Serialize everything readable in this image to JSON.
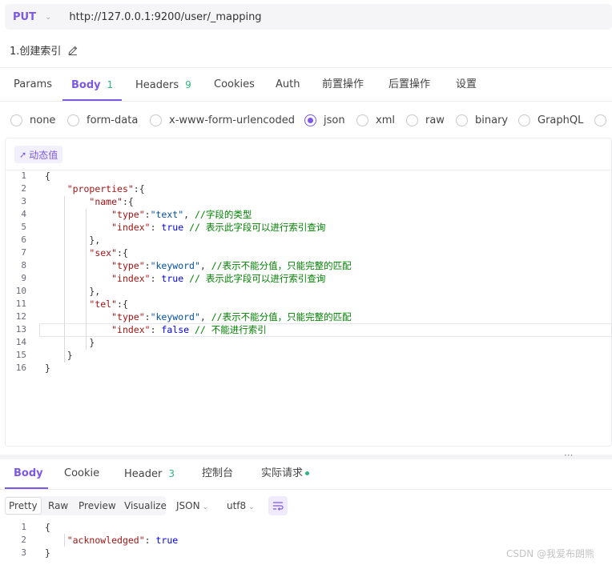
{
  "request": {
    "method": "PUT",
    "url": "http://127.0.0.1:9200/user/_mapping",
    "name": "1.创建索引"
  },
  "tabs": [
    {
      "label": "Params",
      "count": ""
    },
    {
      "label": "Body",
      "count": "1"
    },
    {
      "label": "Headers",
      "count": "9"
    },
    {
      "label": "Cookies",
      "count": ""
    },
    {
      "label": "Auth",
      "count": ""
    },
    {
      "label": "前置操作",
      "count": ""
    },
    {
      "label": "后置操作",
      "count": ""
    },
    {
      "label": "设置",
      "count": ""
    }
  ],
  "active_tab": "Body",
  "body_types": [
    "none",
    "form-data",
    "x-www-form-urlencoded",
    "json",
    "xml",
    "raw",
    "binary",
    "GraphQL"
  ],
  "selected_body_type": "json",
  "dynamic_value_label": "动态值",
  "code_lines": [
    {
      "n": "1",
      "text": "{"
    },
    {
      "n": "2",
      "text": "    \"properties\":{"
    },
    {
      "n": "3",
      "text": "        \"name\":{"
    },
    {
      "n": "4",
      "text": "            \"type\":\"text\", //字段的类型"
    },
    {
      "n": "5",
      "text": "            \"index\": true // 表示此字段可以进行索引查询"
    },
    {
      "n": "6",
      "text": "        },"
    },
    {
      "n": "7",
      "text": "        \"sex\":{"
    },
    {
      "n": "8",
      "text": "            \"type\":\"keyword\", //表示不能分值，只能完整的匹配"
    },
    {
      "n": "9",
      "text": "            \"index\": true // 表示此字段可以进行索引查询"
    },
    {
      "n": "10",
      "text": "        },"
    },
    {
      "n": "11",
      "text": "        \"tel\":{"
    },
    {
      "n": "12",
      "text": "            \"type\":\"keyword\", //表示不能分值，只能完整的匹配"
    },
    {
      "n": "13",
      "text": "            \"index\": false // 不能进行索引"
    },
    {
      "n": "14",
      "text": "        }"
    },
    {
      "n": "15",
      "text": "    }"
    },
    {
      "n": "16",
      "text": "}"
    }
  ],
  "response_tabs": [
    {
      "label": "Body",
      "count": ""
    },
    {
      "label": "Cookie",
      "count": ""
    },
    {
      "label": "Header",
      "count": "3"
    },
    {
      "label": "控制台",
      "count": ""
    },
    {
      "label": "实际请求",
      "count": ""
    }
  ],
  "view_modes": [
    "Pretty",
    "Raw",
    "Preview",
    "Visualize"
  ],
  "selected_view_mode": "Pretty",
  "format": "JSON",
  "encoding": "utf8",
  "response_lines": [
    {
      "n": "1",
      "text": "{"
    },
    {
      "n": "2",
      "text": "    \"acknowledged\": true"
    },
    {
      "n": "3",
      "text": "}"
    }
  ],
  "watermark": "CSDN @我爱布朗熊",
  "colors": {
    "accent": "#7c58e8",
    "count": "#2eb67d"
  }
}
